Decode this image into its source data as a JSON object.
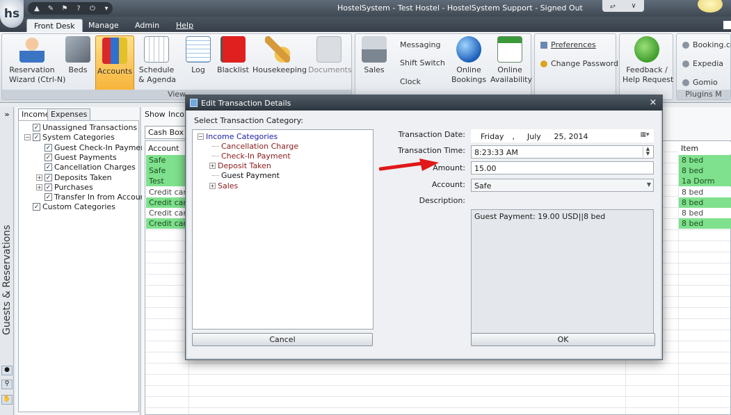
{
  "window": {
    "title": "HostelSystem - Test Hostel - HostelSystem Support - Signed Out",
    "logo_text": "hs"
  },
  "menu": {
    "tabs": [
      {
        "label": "Front Desk"
      },
      {
        "label": "Manage"
      },
      {
        "label": "Admin"
      },
      {
        "label": "Help"
      }
    ]
  },
  "ribbon": {
    "buttons": [
      {
        "label1": "Reservation",
        "label2": "Wizard (Ctrl-N)"
      },
      {
        "label1": "Beds",
        "label2": ""
      },
      {
        "label1": "Accounts",
        "label2": ""
      },
      {
        "label1": "Schedule",
        "label2": "& Agenda"
      },
      {
        "label1": "Log",
        "label2": ""
      },
      {
        "label1": "Blacklist",
        "label2": ""
      },
      {
        "label1": "Housekeeping",
        "label2": ""
      },
      {
        "label1": "Documents",
        "label2": ""
      },
      {
        "label1": "Sales",
        "label2": ""
      },
      {
        "label1": "Online",
        "label2": "Bookings"
      },
      {
        "label1": "Online",
        "label2": "Availability"
      },
      {
        "label1": "Feedback /",
        "label2": "Help Request"
      }
    ],
    "small_buttons": {
      "messaging": "Messaging",
      "shift_switch": "Shift Switch",
      "clock": "Clock",
      "preferences": "Preferences",
      "change_password": "Change Password",
      "booking": "Booking.co",
      "expedia": "Expedia",
      "gomio": "Gomio"
    },
    "group_labels": {
      "view": "View",
      "plugins": "Plugins M"
    }
  },
  "left_strip": {
    "collapse": "»",
    "vertical_label": "Guests & Reservations"
  },
  "category_panel": {
    "tabs": [
      {
        "label": "Income"
      },
      {
        "label": "Expenses"
      }
    ],
    "tree": [
      {
        "label": "Unassigned Transactions",
        "checked": true
      },
      {
        "label": "System Categories",
        "checked": true
      },
      {
        "label": "Guest Check-In Payments",
        "checked": true
      },
      {
        "label": "Guest Payments",
        "checked": true
      },
      {
        "label": "Cancellation Charges",
        "checked": true
      },
      {
        "label": "Deposits Taken",
        "checked": true
      },
      {
        "label": "Purchases",
        "checked": true
      },
      {
        "label": "Transfer In from Account",
        "checked": true
      },
      {
        "label": "Custom Categories",
        "checked": true
      }
    ]
  },
  "main": {
    "show_label": "Show",
    "show_value": "Inco",
    "cashbox_tab": "Cash Box (E",
    "columns": {
      "account": "Account",
      "item": "Item"
    },
    "rows": [
      {
        "account": "Safe",
        "item": "8 bed",
        "highlight": true
      },
      {
        "account": "Safe",
        "item": "8 bed",
        "highlight": true
      },
      {
        "account": "Test",
        "item": "1a Dorm",
        "highlight": true
      },
      {
        "account": "Credit card",
        "item": "8 bed",
        "highlight": false
      },
      {
        "account": "Credit card",
        "item": "8 bed",
        "highlight": true
      },
      {
        "account": "Credit card",
        "item": "8 bed",
        "highlight": false
      },
      {
        "account": "Credit card",
        "item": "8 bed",
        "highlight": true
      }
    ]
  },
  "dialog": {
    "title": "Edit Transaction Details",
    "close": "×",
    "select_category_label": "Select Transaction Category:",
    "category_tree": [
      {
        "label": "Income Categories",
        "kind": "root"
      },
      {
        "label": "Cancellation Charge",
        "kind": "child"
      },
      {
        "label": "Check-In Payment",
        "kind": "child"
      },
      {
        "label": "Deposit Taken",
        "kind": "child"
      },
      {
        "label": "Guest Payment",
        "kind": "selected"
      },
      {
        "label": "Sales",
        "kind": "child"
      }
    ],
    "fields": {
      "date_label": "Transaction Date:",
      "date_day": "Friday",
      "date_sep": ",",
      "date_month": "July",
      "date_rest": "25, 2014",
      "time_label": "Transaction Time:",
      "time_value": "8:23:33 AM",
      "amount_label": "Amount:",
      "amount_value": "15.00",
      "account_label": "Account:",
      "account_value": "Safe",
      "description_label": "Description:",
      "description_value": "Guest Payment: 19.00 USD||8 bed"
    },
    "buttons": {
      "cancel": "Cancel",
      "ok": "OK"
    }
  },
  "colors": {
    "highlight_green": "#7fe08d",
    "arrow_red": "#e01818",
    "selected_ribbon": "#f7b43a"
  }
}
